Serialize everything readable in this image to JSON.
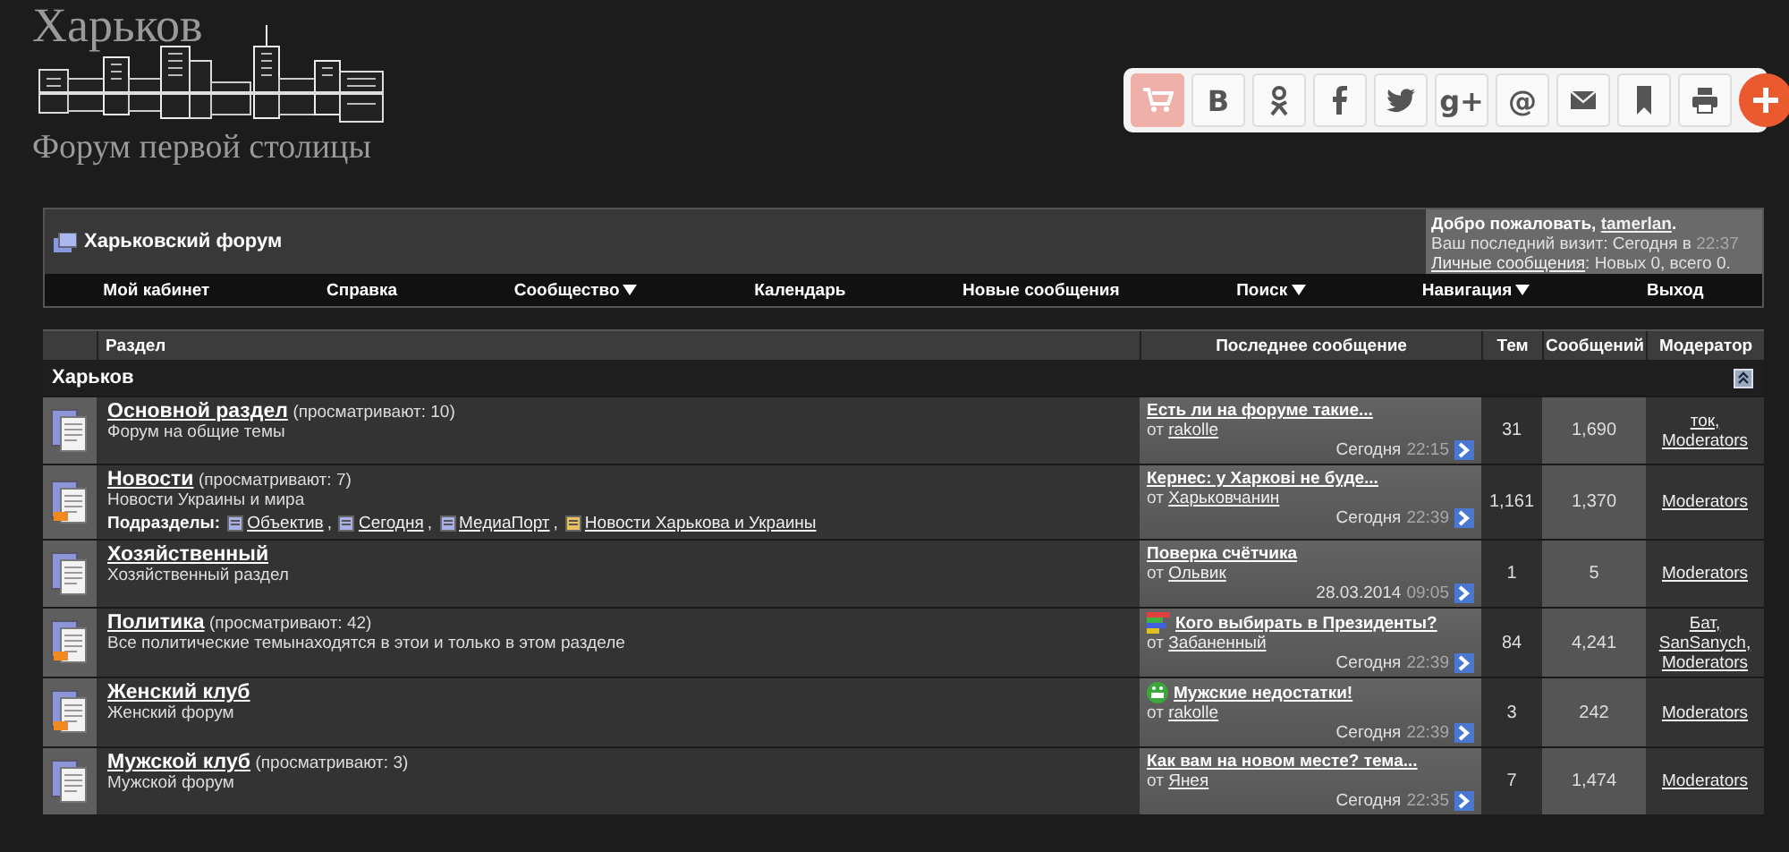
{
  "logo": {
    "title": "Харьков",
    "subtitle": "Форум первой столицы"
  },
  "share_buttons": [
    {
      "kind": "cart"
    },
    {
      "kind": "text",
      "glyph": "B"
    },
    {
      "kind": "ok"
    },
    {
      "kind": "facebook"
    },
    {
      "kind": "twitter"
    },
    {
      "kind": "text",
      "glyph": "g+"
    },
    {
      "kind": "text",
      "glyph": "@"
    },
    {
      "kind": "mail"
    },
    {
      "kind": "bookmark"
    },
    {
      "kind": "print"
    },
    {
      "kind": "plus"
    }
  ],
  "forum_title": "Харьковский форум",
  "welcome": {
    "greeting": "Добро пожаловать,",
    "username": "tamerlan",
    "greeting_end": ".",
    "visit_label": "Ваш последний визит: Сегодня в",
    "visit_time": "22:37",
    "messages_link": "Личные сообщения",
    "messages_info": ": Новых 0, всего 0."
  },
  "nav": [
    {
      "label": "Мой кабинет",
      "dropdown": false
    },
    {
      "label": "Справка",
      "dropdown": false
    },
    {
      "label": "Сообщество",
      "dropdown": true
    },
    {
      "label": "Календарь",
      "dropdown": false
    },
    {
      "label": "Новые сообщения",
      "dropdown": false
    },
    {
      "label": "Поиск",
      "dropdown": true
    },
    {
      "label": "Навигация",
      "dropdown": true
    },
    {
      "label": "Выход",
      "dropdown": false
    }
  ],
  "table": {
    "columns": [
      "Раздел",
      "Последнее сообщение",
      "Тем",
      "Сообщений",
      "Модератор"
    ],
    "category": "Харьков",
    "rows": [
      {
        "title": "Основной раздел",
        "viewers": "(просматривают: 10)",
        "description": "Форум на общие темы",
        "new_posts": false,
        "last_post": {
          "kind": "plain",
          "title": "Есть ли на форуме такие...",
          "from": "от",
          "author": "rakolle",
          "date": "Сегодня",
          "time": "22:15"
        },
        "threads": "31",
        "posts": "1,690",
        "moderators": [
          "ток,",
          "Moderators"
        ]
      },
      {
        "title": "Новости",
        "viewers": "(просматривают: 7)",
        "description": "Новости Украины и мира",
        "new_posts": true,
        "subforums": {
          "label": "Подразделы:",
          "separator": ",",
          "items": [
            {
              "name": "Объектив",
              "new_posts": false
            },
            {
              "name": "Сегодня",
              "new_posts": false
            },
            {
              "name": "МедиаПорт",
              "new_posts": false
            },
            {
              "name": "Новости Харькова и Украины",
              "new_posts": true
            }
          ]
        },
        "last_post": {
          "kind": "plain",
          "title": "Кернес: у Харкові не буде...",
          "from": "от",
          "author": "Харьковчанин",
          "date": "Сегодня",
          "time": "22:39"
        },
        "threads": "1,161",
        "posts": "1,370",
        "moderators": [
          "Moderators"
        ]
      },
      {
        "title": "Хозяйственный",
        "description": "Хозяйственный раздел",
        "new_posts": false,
        "last_post": {
          "kind": "plain",
          "title": "Поверка счётчика",
          "from": "от",
          "author": "Ольвик",
          "date": "28.03.2014",
          "time": "09:05"
        },
        "threads": "1",
        "posts": "5",
        "moderators": [
          "Moderators"
        ]
      },
      {
        "title": "Политика",
        "viewers": "(просматривают: 42)",
        "description": "Все политические темынаходятся в этои и только в этом разделе",
        "new_posts": true,
        "last_post": {
          "kind": "poll",
          "title": "Кого выбирать в Президенты?",
          "from": "от",
          "author": "Забаненный",
          "date": "Сегодня",
          "time": "22:39"
        },
        "threads": "84",
        "posts": "4,241",
        "moderators": [
          "Бат,",
          "SanSanych,",
          "Moderators"
        ]
      },
      {
        "title": "Женский клуб",
        "description": "Женский форум",
        "new_posts": true,
        "last_post": {
          "kind": "smiley",
          "title": "Мужские недостатки!",
          "from": "от",
          "author": "rakolle",
          "date": "Сегодня",
          "time": "22:39"
        },
        "threads": "3",
        "posts": "242",
        "moderators": [
          "Moderators"
        ]
      },
      {
        "title": "Мужской клуб",
        "viewers": "(просматривают: 3)",
        "description": "Мужской форум",
        "new_posts": false,
        "last_post": {
          "kind": "plain",
          "title": "Как вам на новом месте? тема...",
          "from": "от",
          "author": "Янея",
          "date": "Сегодня",
          "time": "22:35"
        },
        "threads": "7",
        "posts": "1,474",
        "moderators": [
          "Moderators"
        ]
      }
    ]
  }
}
